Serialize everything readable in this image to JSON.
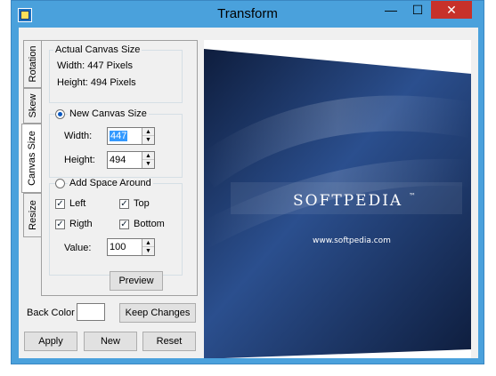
{
  "window": {
    "title": "Transform",
    "controls": {
      "minimize": "—",
      "maximize": "☐",
      "close": "✕"
    },
    "accent": "#4aa1dc",
    "close_color": "#c7312a"
  },
  "tabs": [
    {
      "label": "Rotation"
    },
    {
      "label": "Skew"
    },
    {
      "label": "Canvas Size",
      "active": true
    },
    {
      "label": "Resize"
    }
  ],
  "actual": {
    "title": "Actual Canvas Size",
    "width_text": "Width: 447  Pixels",
    "height_text": "Height: 494  Pixels"
  },
  "new_canvas": {
    "label": "New Canvas Size",
    "selected": true,
    "width_label": "Width:",
    "width_value": "447",
    "height_label": "Height:",
    "height_value": "494"
  },
  "space": {
    "label": "Add Space Around",
    "selected": false,
    "left": "Left",
    "top": "Top",
    "right": "Rigth",
    "bottom": "Bottom",
    "value_label": "Value:",
    "value": "100"
  },
  "buttons": {
    "preview": "Preview",
    "keep": "Keep Changes",
    "apply": "Apply",
    "new": "New",
    "reset": "Reset"
  },
  "back_color": {
    "label": "Back Color",
    "color": "#ffffff"
  },
  "image": {
    "brand": "SOFTPEDIA",
    "trademark": "™",
    "url": "www.softpedia.com",
    "palette": {
      "dark": "#0e1d3d",
      "mid": "#2b4f8e",
      "light": "#6f93cf"
    }
  }
}
